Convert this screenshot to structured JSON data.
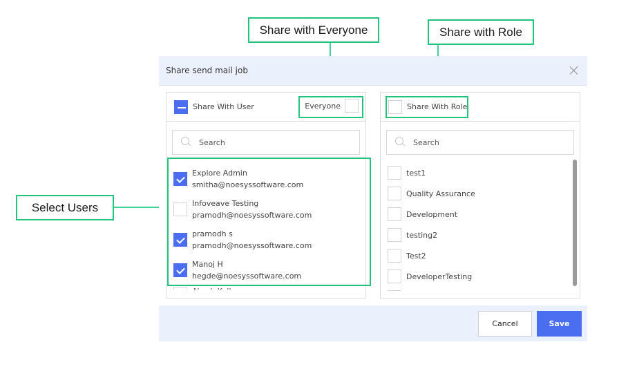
{
  "annotations": {
    "share_everyone": "Share with Everyone",
    "share_role": "Share with Role",
    "select_users": "Select Users",
    "accent_color": "#1fc47d"
  },
  "dialog": {
    "title": "Share send mail job",
    "close_icon": "close-icon",
    "user_panel": {
      "header_label": "Share With User",
      "header_state": "indeterminate",
      "everyone_label": "Everyone",
      "everyone_checked": false,
      "search_placeholder": "Search",
      "users": [
        {
          "name": "Explore Admin",
          "email": "smitha@noesyssoftware.com",
          "checked": true
        },
        {
          "name": "Infoveave Testing",
          "email": "pramodh@noesyssoftware.com",
          "checked": false
        },
        {
          "name": "pramodh s",
          "email": "pramodh@noesyssoftware.com",
          "checked": true
        },
        {
          "name": "Manoj H",
          "email": "hegde@noesyssoftware.com",
          "checked": true
        },
        {
          "name": "Akash Kallur",
          "email": "",
          "checked": false
        }
      ]
    },
    "role_panel": {
      "header_label": "Share With Role",
      "header_checked": false,
      "search_placeholder": "Search",
      "roles": [
        {
          "name": "test1",
          "checked": false
        },
        {
          "name": "Quality Assurance",
          "checked": false
        },
        {
          "name": "Development",
          "checked": false
        },
        {
          "name": "testing2",
          "checked": false
        },
        {
          "name": "Test2",
          "checked": false
        },
        {
          "name": "DeveloperTesting",
          "checked": false
        },
        {
          "name": "",
          "checked": false
        }
      ]
    },
    "footer": {
      "cancel_label": "Cancel",
      "save_label": "Save",
      "primary_color": "#4b6df0"
    }
  }
}
